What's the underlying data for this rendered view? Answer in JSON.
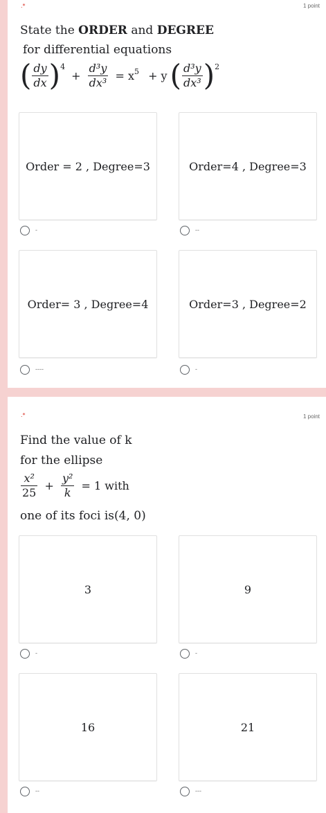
{
  "q1": {
    "required": ".*",
    "points": "1 point",
    "title_prefix": "State the",
    "title_order": "ORDER",
    "title_and": "and",
    "title_degree": "DEGREE",
    "subtitle": "for differential equations",
    "equation": {
      "dy": "dy",
      "dx": "dx",
      "p4": "4",
      "d3y": "d³y",
      "dx3": "dx³",
      "eq": "= x",
      "p5": "5",
      "plus_y": "+ y",
      "p2": "2",
      "plus": "+"
    },
    "options": [
      {
        "label": "Order = 2 , Degree=3",
        "caption": "-"
      },
      {
        "label": "Order=4  , Degree=3",
        "caption": "--"
      },
      {
        "label": "Order= 3  , Degree=4",
        "caption": "----"
      },
      {
        "label": "Order=3  , Degree=2",
        "caption": "-"
      }
    ]
  },
  "q2": {
    "required": ".*",
    "points": "1 point",
    "line1": "Find the value of k",
    "line2": "for the ellipse",
    "equation": {
      "x2": "x²",
      "den1": "25",
      "plus": "+",
      "y2": "y²",
      "den2": "k",
      "rest": "= 1 with"
    },
    "line4": "one of its foci is(4, 0)",
    "options": [
      {
        "label": "3",
        "caption": "-"
      },
      {
        "label": "9",
        "caption": "-"
      },
      {
        "label": "16",
        "caption": "--"
      },
      {
        "label": "21",
        "caption": "---"
      }
    ]
  }
}
